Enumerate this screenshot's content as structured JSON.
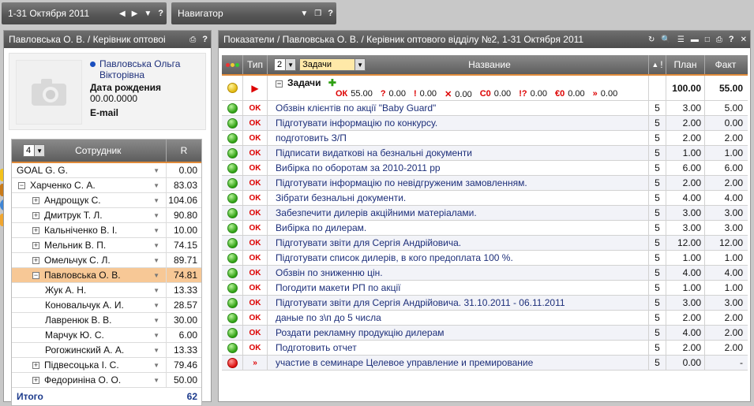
{
  "topbar": {
    "period": "1-31 Октября 2011",
    "navigator": "Навигатор"
  },
  "left_panel": {
    "title": "Павловська О. В. / Керівник оптовоі",
    "user": {
      "name": "Павловська Ольга Вікторівна",
      "birth_label": "Дата рождения",
      "birth_value": "00.00.0000",
      "email_label": "E-mail"
    },
    "employees_header": {
      "level": "4",
      "col_name": "Сотрудник",
      "col_r": "R"
    },
    "employees": [
      {
        "name": "GOAL G. G.",
        "value": "0.00",
        "indent": 0,
        "toggle": ""
      },
      {
        "name": "Харченко С. А.",
        "value": "83.03",
        "indent": 1,
        "toggle": "−"
      },
      {
        "name": "Андрощук С.",
        "value": "104.06",
        "indent": 2,
        "toggle": "+"
      },
      {
        "name": "Дмитрук Т. Л.",
        "value": "90.80",
        "indent": 2,
        "toggle": "+"
      },
      {
        "name": "Кальніченко В. І.",
        "value": "10.00",
        "indent": 2,
        "toggle": "+"
      },
      {
        "name": "Мельник В. П.",
        "value": "74.15",
        "indent": 2,
        "toggle": "+"
      },
      {
        "name": "Омельчук С. Л.",
        "value": "89.71",
        "indent": 2,
        "toggle": "+"
      },
      {
        "name": "Павловська О. В.",
        "value": "74.81",
        "indent": 2,
        "toggle": "−",
        "selected": true
      },
      {
        "name": "Жук А. Н.",
        "value": "13.33",
        "indent": 3,
        "toggle": ""
      },
      {
        "name": "Коновальчук А. И.",
        "value": "28.57",
        "indent": 3,
        "toggle": ""
      },
      {
        "name": "Лавренюк В. В.",
        "value": "30.00",
        "indent": 3,
        "toggle": ""
      },
      {
        "name": "Марчук Ю. С.",
        "value": "6.00",
        "indent": 3,
        "toggle": ""
      },
      {
        "name": "Рогожинский А. А.",
        "value": "13.33",
        "indent": 3,
        "toggle": ""
      },
      {
        "name": "Підвесоцька І. С.",
        "value": "79.46",
        "indent": 2,
        "toggle": "+"
      },
      {
        "name": "Федориніна О. О.",
        "value": "50.00",
        "indent": 2,
        "toggle": "+"
      }
    ],
    "total_label": "Итого",
    "total_value": "62"
  },
  "right_panel": {
    "title": "Показатели / Павловська О. В. / Керівник оптового відділу №2, 1-31 Октября 2011",
    "header": {
      "col_type": "Тип",
      "level": "2",
      "kind": "Задачи",
      "col_name": "Название",
      "col_prio": "!",
      "col_plan": "План",
      "col_fact": "Факт"
    },
    "group": {
      "title": "Задачи",
      "plan": "100.00",
      "fact": "55.00",
      "stats": [
        {
          "sym": "ОК",
          "val": "55.00"
        },
        {
          "sym": "?",
          "val": "0.00"
        },
        {
          "sym": "!",
          "val": "0.00"
        },
        {
          "sym": "✕",
          "val": "0.00"
        },
        {
          "sym": "С0",
          "val": "0.00"
        },
        {
          "sym": "!?",
          "val": "0.00"
        },
        {
          "sym": "€0",
          "val": "0.00"
        },
        {
          "sym": "»",
          "val": "0.00"
        }
      ]
    },
    "tasks": [
      {
        "status": "green",
        "type": "OK",
        "name": "Обзвін клієнтів по акції \"Baby Guard\"",
        "prio": "5",
        "plan": "3.00",
        "fact": "5.00"
      },
      {
        "status": "green",
        "type": "OK",
        "name": "Підготувати інформацію по конкурсу.",
        "prio": "5",
        "plan": "2.00",
        "fact": "0.00"
      },
      {
        "status": "green",
        "type": "OK",
        "name": "подготовить З/П",
        "prio": "5",
        "plan": "2.00",
        "fact": "2.00"
      },
      {
        "status": "green",
        "type": "OK",
        "name": "Підписати видаткові на безнальні документи",
        "prio": "5",
        "plan": "1.00",
        "fact": "1.00"
      },
      {
        "status": "green",
        "type": "OK",
        "name": "Вибірка по оборотам за 2010-2011 рр",
        "prio": "5",
        "plan": "6.00",
        "fact": "6.00"
      },
      {
        "status": "green",
        "type": "OK",
        "name": "Підготувати інформацію по невідгруженим замовленням.",
        "prio": "5",
        "plan": "2.00",
        "fact": "2.00"
      },
      {
        "status": "green",
        "type": "OK",
        "name": "Зібрати безнальні документи.",
        "prio": "5",
        "plan": "4.00",
        "fact": "4.00"
      },
      {
        "status": "green",
        "type": "OK",
        "name": "Забезпечити дилерів акційними матеріалами.",
        "prio": "5",
        "plan": "3.00",
        "fact": "3.00"
      },
      {
        "status": "green",
        "type": "OK",
        "name": "Вибірка по дилерам.",
        "prio": "5",
        "plan": "3.00",
        "fact": "3.00"
      },
      {
        "status": "green",
        "type": "OK",
        "name": "Підготувати звіти для Сергія Андрійовича.",
        "prio": "5",
        "plan": "12.00",
        "fact": "12.00"
      },
      {
        "status": "green",
        "type": "OK",
        "name": "Підготувати список дилерів, в кого предоплата 100 %.",
        "prio": "5",
        "plan": "1.00",
        "fact": "1.00"
      },
      {
        "status": "green",
        "type": "OK",
        "name": "Обзвін по зниженню цін.",
        "prio": "5",
        "plan": "4.00",
        "fact": "4.00"
      },
      {
        "status": "green",
        "type": "OK",
        "name": "Погодити макети РП по акції",
        "prio": "5",
        "plan": "1.00",
        "fact": "1.00"
      },
      {
        "status": "green",
        "type": "OK",
        "name": "Підготувати звіти для Сергія Андрійовича. 31.10.2011 - 06.11.2011",
        "prio": "5",
        "plan": "3.00",
        "fact": "3.00"
      },
      {
        "status": "green",
        "type": "OK",
        "name": "даные по з\\п до 5 числа",
        "prio": "5",
        "plan": "2.00",
        "fact": "2.00"
      },
      {
        "status": "green",
        "type": "OK",
        "name": "Роздати рекламну продукцію дилерам",
        "prio": "5",
        "plan": "4.00",
        "fact": "2.00"
      },
      {
        "status": "green",
        "type": "OK",
        "name": "Подготовить отчет",
        "prio": "5",
        "plan": "2.00",
        "fact": "2.00"
      },
      {
        "status": "red",
        "type": "»",
        "name": "участие в семинаре Целевое управление и премирование",
        "prio": "5",
        "plan": "0.00",
        "fact": "-"
      }
    ]
  }
}
